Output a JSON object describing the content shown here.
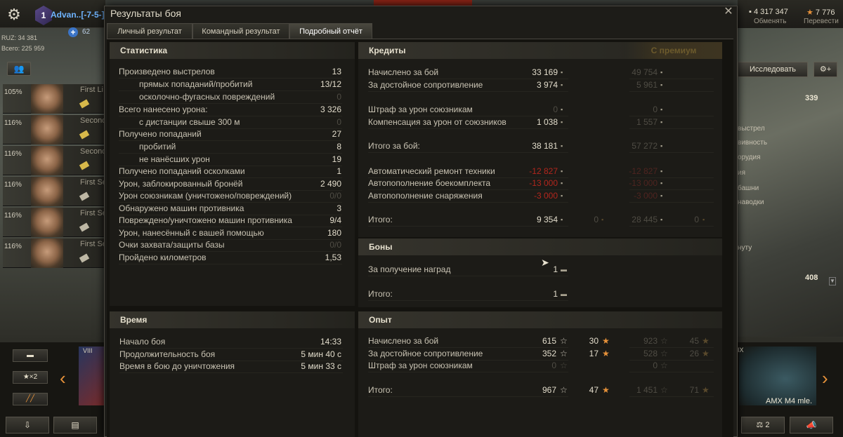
{
  "hangar": {
    "player_name": "Advan..[-7-5-]",
    "rank": "1",
    "plus_value": "62",
    "ruz": "RUZ: 34 381",
    "total": "Всего: 225 959",
    "crew": [
      {
        "pct": "105%",
        "role": "First Li"
      },
      {
        "pct": "116%",
        "role": "Second"
      },
      {
        "pct": "116%",
        "role": "Second"
      },
      {
        "pct": "116%",
        "role": "First Se"
      },
      {
        "pct": "116%",
        "role": "First Se"
      },
      {
        "pct": "116%",
        "role": "First Se"
      }
    ],
    "credits": "4 317 347",
    "credits_label": "Обменять",
    "gold": "7 776",
    "gold_label": "Перевести",
    "research_label": "Исследовать",
    "value_339": "339",
    "value_408": "408",
    "right_texts": [
      "выстрел",
      "вивность",
      "орудия",
      "ия",
      "башни",
      "наводки",
      "нуту"
    ],
    "x2_label": "×2",
    "left_tank_tier": "VIII",
    "right_tank_tier": "IX",
    "right_tank_name": "AMX M4 mle.",
    "compare_count": "2",
    "colors": {
      "accent": "#e7923a",
      "player": "#6fb4ff"
    }
  },
  "window": {
    "title": "Результаты боя",
    "tabs": [
      "Личный результат",
      "Командный результат",
      "Подробный отчёт"
    ],
    "active_tab": 2
  },
  "stats": {
    "header": "Статистика",
    "rows": [
      {
        "label": "Произведено выстрелов",
        "value": "13",
        "indent": false,
        "dim": false
      },
      {
        "label": "прямых попаданий/пробитий",
        "value": "13/12",
        "indent": true,
        "dim": false
      },
      {
        "label": "осколочно-фугасных повреждений",
        "value": "0",
        "indent": true,
        "dim": true
      },
      {
        "label": "Всего нанесено урона:",
        "value": "3 326",
        "indent": false,
        "dim": false
      },
      {
        "label": "с дистанции свыше 300 м",
        "value": "0",
        "indent": true,
        "dim": true
      },
      {
        "label": "Получено попаданий",
        "value": "27",
        "indent": false,
        "dim": false
      },
      {
        "label": "пробитий",
        "value": "8",
        "indent": true,
        "dim": false
      },
      {
        "label": "не нанёсших урон",
        "value": "19",
        "indent": true,
        "dim": false
      },
      {
        "label": "Получено попаданий осколками",
        "value": "1",
        "indent": false,
        "dim": false
      },
      {
        "label": "Урон, заблокированный бронёй",
        "value": "2 490",
        "indent": false,
        "dim": false
      },
      {
        "label": "Урон союзникам (уничтожено/повреждений)",
        "value": "0/0",
        "indent": false,
        "dim": true
      },
      {
        "label": "Обнаружено машин противника",
        "value": "3",
        "indent": false,
        "dim": false
      },
      {
        "label": "Повреждено/уничтожено машин противника",
        "value": "9/4",
        "indent": false,
        "dim": false
      },
      {
        "label": "Урон, нанесённый с вашей помощью",
        "value": "180",
        "indent": false,
        "dim": false
      },
      {
        "label": "Очки захвата/защиты базы",
        "value": "0/0",
        "indent": false,
        "dim": true
      },
      {
        "label": "Пройдено километров",
        "value": "1,53",
        "indent": false,
        "dim": false
      }
    ]
  },
  "time": {
    "header": "Время",
    "rows": [
      {
        "label": "Начало боя",
        "value": "14:33"
      },
      {
        "label": "Продолжительность боя",
        "value": "5 мин 40 с"
      },
      {
        "label": "Время в бою до уничтожения",
        "value": "5 мин 33 с"
      }
    ]
  },
  "credits": {
    "header": "Кредиты",
    "premium_header": "С премиум",
    "rows": [
      {
        "label": "Начислено за бой",
        "value": "33 169",
        "premium": "49 754",
        "kind": "normal"
      },
      {
        "label": "За достойное сопротивление",
        "value": "3 974",
        "premium": "5 961",
        "kind": "normal"
      },
      {
        "label": "Штраф за урон союзникам",
        "value": "0",
        "premium": "0",
        "kind": "dimval"
      },
      {
        "label": "Компенсация за урон от союзников",
        "value": "1 038",
        "premium": "1 557",
        "kind": "normal"
      },
      {
        "label": "Итого за бой:",
        "value": "38 181",
        "premium": "57 272",
        "kind": "normal"
      },
      {
        "label": "Автоматический ремонт техники",
        "value": "-12 827",
        "premium": "-12 827",
        "kind": "red"
      },
      {
        "label": "Автопополнение боекомплекта",
        "value": "-13 000",
        "premium": "-13 000",
        "kind": "red"
      },
      {
        "label": "Автопополнение снаряжения",
        "value": "-3 000",
        "premium": "-3 000",
        "kind": "red"
      },
      {
        "label": "Итого:",
        "value": "9 354",
        "gold": "0",
        "premium": "28 445",
        "premium_gold": "0",
        "kind": "total"
      }
    ]
  },
  "bonds": {
    "header": "Боны",
    "rows": [
      {
        "label": "За получение наград",
        "value": "1"
      },
      {
        "label": "Итого:",
        "value": "1"
      }
    ]
  },
  "xp": {
    "header": "Опыт",
    "rows": [
      {
        "label": "Начислено за бой",
        "xp": "615",
        "free": "30",
        "pxp": "923",
        "pfree": "45",
        "dim": false
      },
      {
        "label": "За достойное сопротивление",
        "xp": "352",
        "free": "17",
        "pxp": "528",
        "pfree": "26",
        "dim": false
      },
      {
        "label": "Штраф за урон союзникам",
        "xp": "0",
        "free": "",
        "pxp": "0",
        "pfree": "",
        "dim": true
      },
      {
        "label": "Итого:",
        "xp": "967",
        "free": "47",
        "pxp": "1 451",
        "pfree": "71",
        "dim": false
      }
    ]
  }
}
